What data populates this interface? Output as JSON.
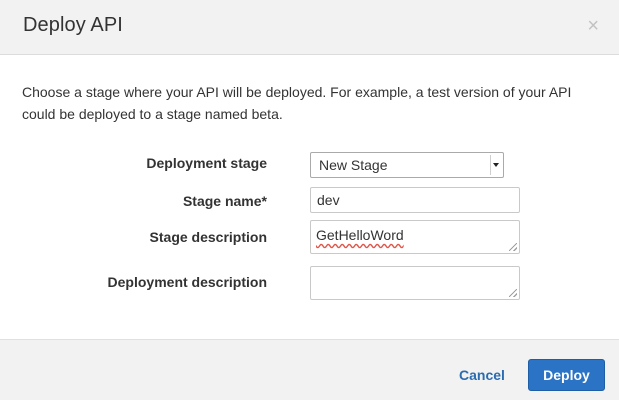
{
  "dialog": {
    "title": "Deploy API",
    "close_glyph": "×",
    "intro": "Choose a stage where your API will be deployed. For example, a test version of your API could be deployed to a stage named beta."
  },
  "form": {
    "deployment_stage": {
      "label": "Deployment stage",
      "value": "New Stage"
    },
    "stage_name": {
      "label": "Stage name*",
      "value": "dev"
    },
    "stage_description": {
      "label": "Stage description",
      "value": "GetHelloWord"
    },
    "deployment_description": {
      "label": "Deployment description",
      "value": ""
    }
  },
  "footer": {
    "cancel_label": "Cancel",
    "deploy_label": "Deploy"
  },
  "colors": {
    "header_bg": "#f2f2f2",
    "footer_bg": "#f2f2f2",
    "primary_button": "#2a73c5",
    "link": "#2b6cb0"
  },
  "icons": {
    "close": "close-icon",
    "select_arrow": "chevron-down-icon",
    "resize": "resize-grip-icon"
  }
}
